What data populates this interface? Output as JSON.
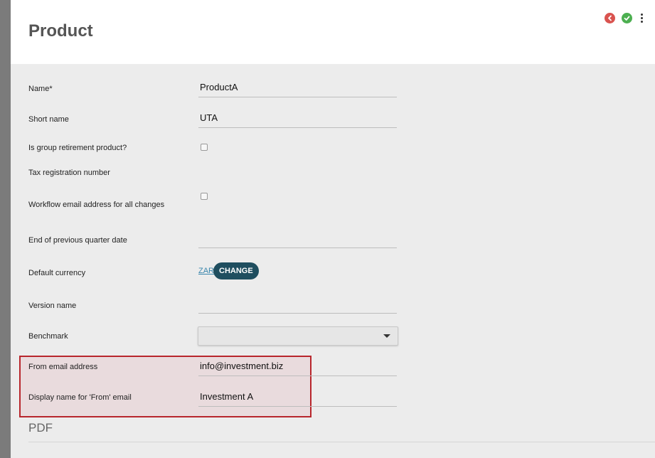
{
  "header": {
    "title": "Product",
    "actions": {
      "back_icon": "back-icon",
      "confirm_icon": "check-icon",
      "more_icon": "kebab-menu-icon"
    },
    "colors": {
      "back": "#d9534f",
      "confirm": "#4caf50"
    }
  },
  "form": {
    "name": {
      "label": "Name*",
      "value": "ProductA"
    },
    "short_name": {
      "label": "Short name",
      "value": "UTA"
    },
    "is_group_retirement": {
      "label": "Is group retirement product?",
      "checked": false
    },
    "tax_registration": {
      "label": "Tax registration number"
    },
    "workflow_email": {
      "label": "Workflow email address for all changes",
      "checked": false
    },
    "end_quarter_date": {
      "label": "End of previous quarter date",
      "value": ""
    },
    "default_currency": {
      "label": "Default currency",
      "value": "ZAR",
      "button": "CHANGE"
    },
    "version_name": {
      "label": "Version name",
      "value": ""
    },
    "benchmark": {
      "label": "Benchmark",
      "selected": ""
    },
    "from_email": {
      "label": "From email address",
      "value": "info@investment.biz"
    },
    "display_name": {
      "label": "Display name for 'From' email",
      "value": "Investment A"
    }
  },
  "sections": {
    "pdf_title": "PDF"
  },
  "colors": {
    "highlight_border": "#b8262c",
    "change_button": "#1f4e5f",
    "link": "#3a87ad"
  }
}
